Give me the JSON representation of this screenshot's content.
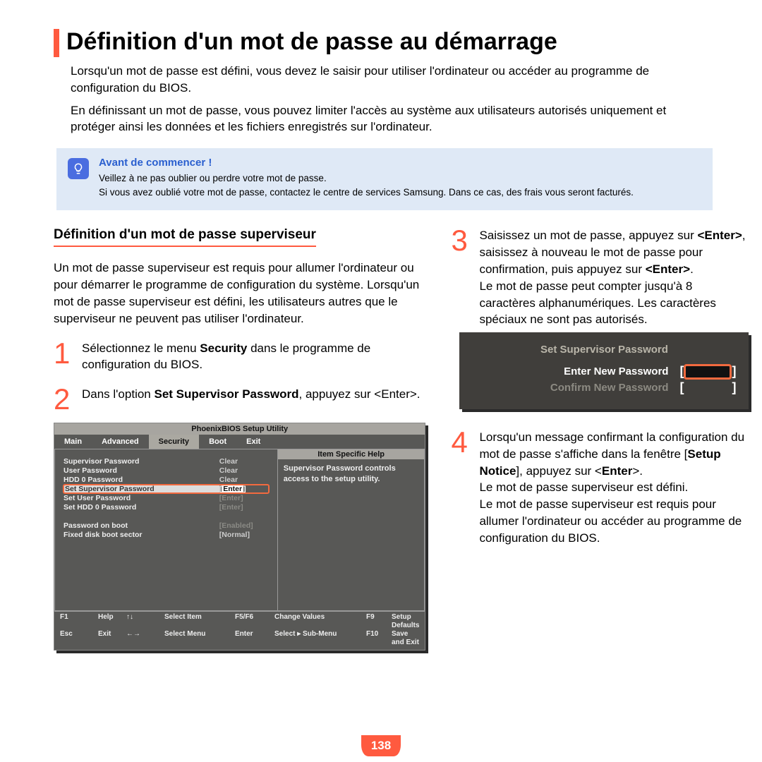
{
  "title": "Définition d'un mot de passe au démarrage",
  "intro1": "Lorsqu'un mot de passe est défini, vous devez le saisir pour utiliser l'ordinateur ou accéder au programme de configuration du BIOS.",
  "intro2": "En définissant un mot de passe, vous pouvez limiter l'accès au système aux utilisateurs autorisés uniquement et protéger ainsi les données et les fichiers enregistrés sur l'ordinateur.",
  "callout": {
    "title": "Avant de commencer !",
    "line1": "Veillez à ne pas oublier ou perdre votre mot de passe.",
    "line2": "Si vous avez oublié votre mot de passe, contactez le centre de services Samsung. Dans ce cas, des frais vous seront facturés."
  },
  "section_title": "Définition d'un mot de passe superviseur",
  "section_para": "Un mot de passe superviseur est requis pour allumer l'ordinateur ou pour démarrer le programme de configuration du système. Lorsqu'un mot de passe superviseur est défini, les utilisateurs autres que le superviseur ne peuvent pas utiliser l'ordinateur.",
  "steps": {
    "s1_pre": "Sélectionnez le menu ",
    "s1_bold": "Security",
    "s1_post": " dans le programme de configuration du BIOS.",
    "s2_pre": "Dans l'option ",
    "s2_bold": "Set Supervisor Password",
    "s2_post": ", appuyez sur <Enter>.",
    "s3_line1a": "Saisissez un mot de passe, appuyez sur ",
    "s3_line1b": "<Enter>",
    "s3_line1c": ", saisissez à nouveau le mot de passe pour confirmation, puis appuyez sur ",
    "s3_line1d": "<Enter>",
    "s3_line1e": ".",
    "s3_line2": "Le mot de passe peut compter jusqu'à 8 caractères alphanumériques. Les caractères spéciaux ne sont pas autorisés.",
    "s4_pre": "Lorsqu'un message confirmant la configuration du mot de passe s'affiche dans la fenêtre [",
    "s4_bold": "Setup Notice",
    "s4_mid": "], appuyez sur <",
    "s4_bold2": "Enter",
    "s4_post": ">.",
    "s4_line2": "Le mot de passe superviseur est défini.",
    "s4_line3": "Le mot de passe superviseur est requis pour allumer l'ordinateur ou accéder au programme de configuration du BIOS."
  },
  "bios": {
    "title": "PhoenixBIOS Setup Utility",
    "tabs": [
      "Main",
      "Advanced",
      "Security",
      "Boot",
      "Exit"
    ],
    "help_title": "Item Specific Help",
    "help_body": "Supervisor Password controls access to the setup utility.",
    "rows": [
      {
        "label": "Supervisor Password",
        "value": "Clear",
        "dim": false
      },
      {
        "label": "User Password",
        "value": "Clear",
        "dim": false
      },
      {
        "label": "HDD 0 Password",
        "value": "Clear",
        "dim": false
      }
    ],
    "hl": {
      "label": "Set Supervisor Password",
      "value": "Enter"
    },
    "rows2": [
      {
        "label": "Set User Password",
        "value": "[Enter]",
        "dim": true
      },
      {
        "label": "Set HDD 0 Password",
        "value": "[Enter]",
        "dim": true
      }
    ],
    "rows3": [
      {
        "label": "Password on boot",
        "value": "[Enabled]",
        "dim": true
      },
      {
        "label": "Fixed disk boot sector",
        "value": "[Normal]",
        "dim": false
      }
    ],
    "footer": {
      "r1": {
        "a": "F1",
        "b": "Help",
        "c": "↑↓",
        "d": "Select Item",
        "e": "F5/F6",
        "f": "Change Values",
        "g": "F9",
        "h": "Setup Defaults"
      },
      "r2": {
        "a": "Esc",
        "b": "Exit",
        "c": "←→",
        "d": "Select Menu",
        "e": "Enter",
        "f": "Select ▸ Sub-Menu",
        "g": "F10",
        "h": "Save and Exit"
      }
    }
  },
  "dialog": {
    "title": "Set Supervisor Password",
    "label1": "Enter New Password",
    "label2": "Confirm New Password"
  },
  "page_number": "138",
  "nums": {
    "n1": "1",
    "n2": "2",
    "n3": "3",
    "n4": "4"
  }
}
